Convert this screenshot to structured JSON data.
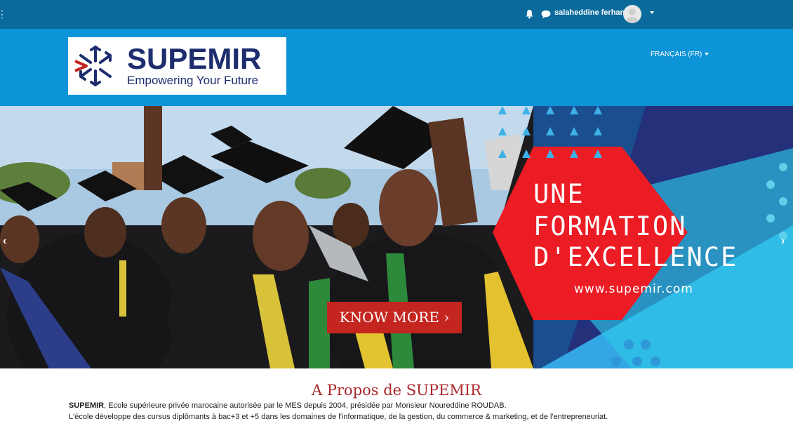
{
  "topbar": {
    "user_name": "salaheddine ferhan",
    "icons": [
      "menu-toggle-icon",
      "bell-icon",
      "chat-icon",
      "avatar",
      "caret-down-icon"
    ]
  },
  "header": {
    "logo_title": "SUPEMIR",
    "logo_tagline": "Empowering Your Future",
    "language": "FRANÇAIS (FR)"
  },
  "hero": {
    "line1": "UNE",
    "line2": "FORMATION",
    "line3": "D'EXCELLENCE",
    "url": "www.supemir.com",
    "cta": "KNOW MORE ›",
    "prev": "‹",
    "next": "›"
  },
  "about": {
    "title": "A Propos de SUPEMIR",
    "p1_strong": "SUPEMIR",
    "p1_rest": ", Ecole supérieure privée marocaine autorisée par le MES depuis 2004, présidée par Monsieur Noureddine ROUDAB.",
    "p2": "L'école développe des cursus diplômants à bac+3 et +5 dans les domaines de l'informatique, de la gestion, du commerce & marketing, et de l'entrepreneuriat."
  },
  "colors": {
    "topbar": "#0a6a9c",
    "header": "#0c93d8",
    "brand_navy": "#1d2d6e",
    "brand_red": "#c4251f",
    "about_title": "#a8282a"
  }
}
